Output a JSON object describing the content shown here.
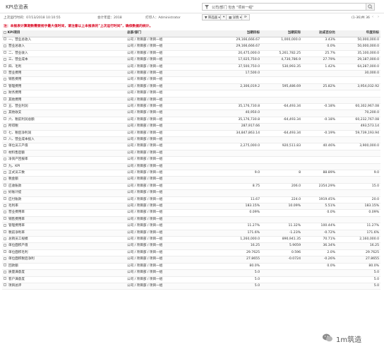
{
  "page": {
    "title": "KPI总览表"
  },
  "filter": {
    "text": "公司/部门 包含 \"项目一组\""
  },
  "info": {
    "last_run": "上次运行时间：07/13/2018 10:10:55",
    "fiscal_year": "会计年度：2018",
    "printer": "打印人：Administrator"
  },
  "toolbar": {
    "filter_btn": "▼ 筛选器 ▾",
    "group_btn": "▾",
    "columns_btn": "▦ 详情 ▾",
    "refresh_btn": "⟳"
  },
  "pager": {
    "range": "(1-36)共 36"
  },
  "notice": "注：本报表计算期数需要视乎最大值时间，请注意以上本报表的\"上次运行时间\"，确保数据的统计。",
  "columns": [
    "KPI项目",
    "总部/部门",
    "当期目标",
    "当期实际",
    "达成百分比",
    "年度目标"
  ],
  "rows": [
    [
      "一、营业总收入",
      "公司 / 项目部 / 项目一组",
      "29,166,666.67",
      "1,000,000.0",
      "3.43%",
      "50,000,000.0"
    ],
    [
      "营业总收入",
      "公司 / 项目部 / 项目一组",
      "29,166,666.67",
      "",
      "0.0%",
      "50,000,000.0"
    ],
    [
      "二、营业收入",
      "公司 / 项目部 / 项目一组",
      "20,475,000.0",
      "5,261,782.25",
      "25.7%",
      "35,100,000.0"
    ],
    [
      "三、营业成本",
      "公司 / 项目部 / 项目一组",
      "17,025,750.0",
      "4,730,786.9",
      "27.79%",
      "29,187,000.0"
    ],
    [
      "四、毛利",
      "公司 / 项目部 / 项目一组",
      "37,500,750.0",
      "530,993.35",
      "1.42%",
      "64,287,000.0"
    ],
    [
      "营业费用",
      "公司 / 项目部 / 项目一组",
      "17,500.0",
      "",
      "",
      "30,000.0"
    ],
    [
      "销售费用",
      "公司 / 项目部 / 项目一组",
      "",
      "",
      "",
      ""
    ],
    [
      "管理费用",
      "公司 / 项目部 / 项目一组",
      "2,306,019.2",
      "595,486.69",
      "25.82%",
      "3,954,032.92"
    ],
    [
      "财务费用",
      "公司 / 项目部 / 项目一组",
      "",
      "",
      "",
      ""
    ],
    [
      "其他费用",
      "公司 / 项目部 / 项目一组",
      "",
      "",
      "",
      ""
    ],
    [
      "五、营业利润",
      "公司 / 项目部 / 项目一组",
      "35,176,730.8",
      "-64,493.34",
      "-0.18%",
      "60,302,967.08"
    ],
    [
      "其他收支",
      "公司 / 项目部 / 项目一组",
      "40,950.0",
      "",
      "",
      "70,200.0"
    ],
    [
      "六、税前利润总额",
      "公司 / 项目部 / 项目一组",
      "35,176,730.8",
      "-64,493.34",
      "-0.18%",
      "60,232,767.08"
    ],
    [
      "所得税",
      "公司 / 项目部 / 项目一组",
      "287,917.66",
      "",
      "",
      "493,573.14"
    ],
    [
      "七、税后净利润",
      "公司 / 项目部 / 项目一组",
      "34,847,863.14",
      "-64,493.34",
      "-0.19%",
      "59,739,193.94"
    ],
    [
      "八、营业成本投入",
      "公司 / 项目部 / 项目一组",
      "",
      "",
      "",
      ""
    ],
    [
      "单位员工产值",
      "公司 / 项目部 / 项目一组",
      "2,275,000.0",
      "920,511.83",
      "40.46%",
      "3,900,000.0"
    ],
    [
      "材料售后额",
      "公司 / 项目部 / 项目一组",
      "",
      "",
      "",
      ""
    ],
    [
      "净资产回报率",
      "公司 / 项目部 / 项目一组",
      "",
      "",
      "",
      ""
    ],
    [
      "九、KPI",
      "公司 / 项目部 / 项目一组",
      "",
      "",
      "",
      ""
    ],
    [
      "正式员工数",
      "公司 / 项目部 / 项目一组",
      "9.0",
      "8",
      "88.89%",
      "9.0"
    ],
    [
      "税金额",
      "公司 / 项目部 / 项目一组",
      "",
      "",
      "",
      ""
    ],
    [
      "应收账款",
      "公司 / 项目部 / 项目一组",
      "8.75",
      "206.0",
      "2354.29%",
      "15.0"
    ],
    [
      "好账计提",
      "公司 / 项目部 / 项目一组",
      "",
      "",
      "",
      ""
    ],
    [
      "应付账款",
      "公司 / 项目部 / 项目一组",
      "11.67",
      "224.0",
      "1919.45%",
      "20.0"
    ],
    [
      "毛利率",
      "公司 / 项目部 / 项目一组",
      "183.15%",
      "10.09%",
      "5.51%",
      "183.15%"
    ],
    [
      "营业费用率",
      "公司 / 项目部 / 项目一组",
      "0.09%",
      "",
      "0.0%",
      "0.09%"
    ],
    [
      "销售费用率",
      "公司 / 项目部 / 项目一组",
      "",
      "",
      "",
      ""
    ],
    [
      "管理费用率",
      "公司 / 项目部 / 项目一组",
      "11.27%",
      "11.32%",
      "100.44%",
      "11.27%"
    ],
    [
      "税前净利率",
      "公司 / 项目部 / 项目一组",
      "171.6%",
      "-1.23%",
      "-0.72%",
      "171.6%"
    ],
    [
      "总销员工规模",
      "公司 / 项目部 / 项目一组",
      "1,260,000.0",
      "890,941.35",
      "70.71%",
      "2,160,000.0"
    ],
    [
      "单位面积产值",
      "公司 / 项目部 / 项目一组",
      "16.25",
      "5.9059",
      "36.34%",
      "16.25"
    ],
    [
      "单位面积毛利",
      "公司 / 项目部 / 项目一组",
      "29.7625",
      "0.596",
      "2.0%",
      "29.7625"
    ],
    [
      "单位面积税后净利",
      "公司 / 项目部 / 项目一组",
      "27.8655",
      "-0.0724",
      "-0.26%",
      "27.8655"
    ],
    [
      "回款额",
      "公司 / 项目部 / 项目一组",
      "80.0%",
      "",
      "0.0%",
      "80.0%"
    ],
    [
      "质量满意度",
      "公司 / 项目部 / 项目一组",
      "5.0",
      "",
      "",
      "5.0"
    ],
    [
      "客户满意度",
      "公司 / 项目部 / 项目一组",
      "5.0",
      "",
      "",
      "5.0"
    ],
    [
      "项目总评",
      "公司 / 项目部 / 项目一组",
      "5.0",
      "",
      "",
      "5.0"
    ]
  ],
  "watermark": {
    "text": "1m筑造",
    "icon": "wechat-icon"
  }
}
